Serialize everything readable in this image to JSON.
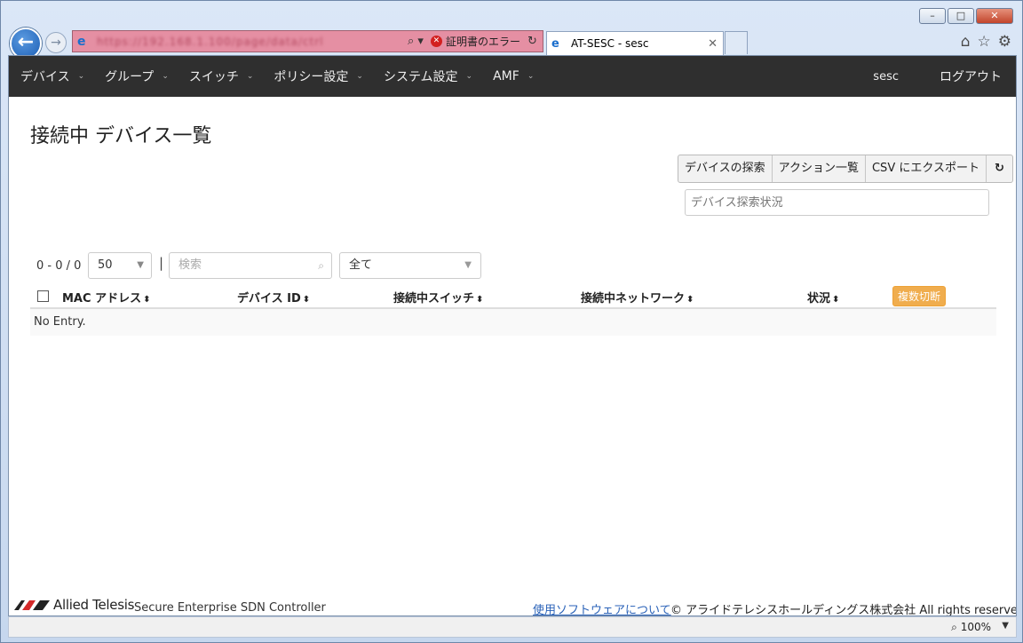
{
  "browser": {
    "url": "https://192.168.1.100/page/data/ctrl",
    "cert_error": "証明書のエラー",
    "tab_title": "AT-SESC - sesc",
    "zoom": "100%"
  },
  "nav": {
    "items": [
      {
        "label": "デバイス"
      },
      {
        "label": "グループ"
      },
      {
        "label": "スイッチ"
      },
      {
        "label": "ポリシー設定"
      },
      {
        "label": "システム設定"
      },
      {
        "label": "AMF"
      }
    ],
    "user": "sesc",
    "logout": "ログアウト"
  },
  "page": {
    "title": "接続中 デバイス一覧",
    "actions": {
      "discover": "デバイスの探索",
      "action_list": "アクション一覧",
      "csv_export": "CSV にエクスポート"
    },
    "scan_status_placeholder": "デバイス探索状況",
    "range_text": "0 - 0 / 0",
    "page_size": "50",
    "search_placeholder": "検索",
    "filter_value": "全て"
  },
  "table": {
    "columns": {
      "mac": "MAC アドレス",
      "device_id": "デバイス ID",
      "switch": "接続中スイッチ",
      "network": "接続中ネットワーク",
      "status": "状況"
    },
    "bulk_disconnect": "複数切断",
    "empty": "No Entry."
  },
  "footer": {
    "brand": "Allied Telesis",
    "product": "Secure Enterprise SDN Controller",
    "software_link": "使用ソフトウェアについて",
    "copyright": "© アライドテレシスホールディングス株式会社 All rights reserved."
  }
}
